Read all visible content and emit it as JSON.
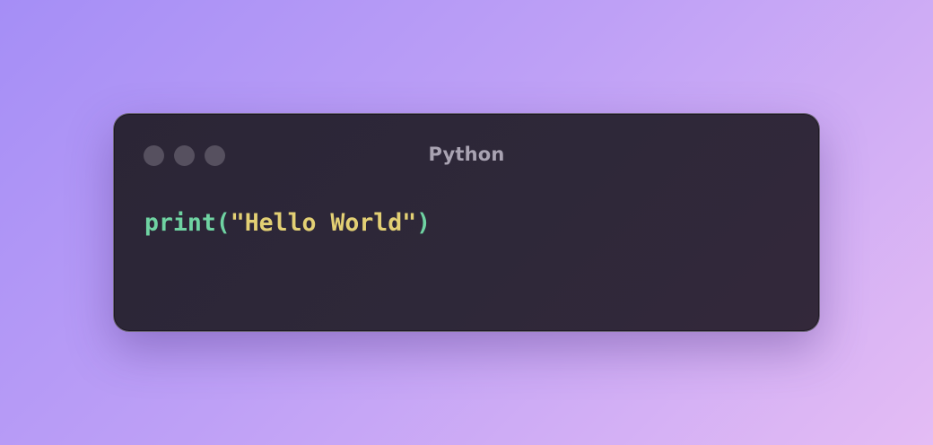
{
  "window": {
    "title": "Python",
    "controls": [
      "close-dot",
      "minimize-dot",
      "maximize-dot"
    ]
  },
  "code": {
    "function": "print",
    "open_paren": "(",
    "string": "\"Hello World\"",
    "close_paren": ")"
  },
  "colors": {
    "function": "#6fd3a2",
    "string": "#e3d074",
    "title": "#a9a3b2",
    "window_bg": "#2e2839",
    "dot": "#56505f"
  }
}
